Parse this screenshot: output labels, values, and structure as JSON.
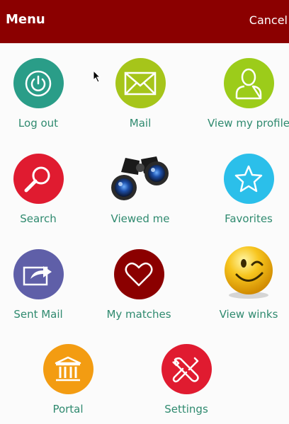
{
  "header": {
    "title": "Menu",
    "cancel_label": "Cancel"
  },
  "menu": {
    "logout": {
      "label": "Log out",
      "icon": "power-icon",
      "color": "#2a9d88"
    },
    "mail": {
      "label": "Mail",
      "icon": "envelope-icon",
      "color": "#a6c51a"
    },
    "profile": {
      "label": "View my profile",
      "icon": "person-icon",
      "color": "#9ccc1a"
    },
    "search": {
      "label": "Search",
      "icon": "magnifier-icon",
      "color": "#e01b30"
    },
    "viewed": {
      "label": "Viewed me",
      "icon": "binoculars-icon",
      "color": "#2a2a2a"
    },
    "favorites": {
      "label": "Favorites",
      "icon": "star-icon",
      "color": "#2bbfea"
    },
    "sent": {
      "label": "Sent Mail",
      "icon": "sent-mail-icon",
      "color": "#5f5fa8"
    },
    "matches": {
      "label": "My matches",
      "icon": "heart-icon",
      "color": "#8b0000"
    },
    "winks": {
      "label": "View winks",
      "icon": "wink-smiley-icon",
      "color": "#f7c51e"
    },
    "portal": {
      "label": "Portal",
      "icon": "bank-icon",
      "color": "#f39c12"
    },
    "settings": {
      "label": "Settings",
      "icon": "tools-icon",
      "color": "#e01b30"
    }
  }
}
